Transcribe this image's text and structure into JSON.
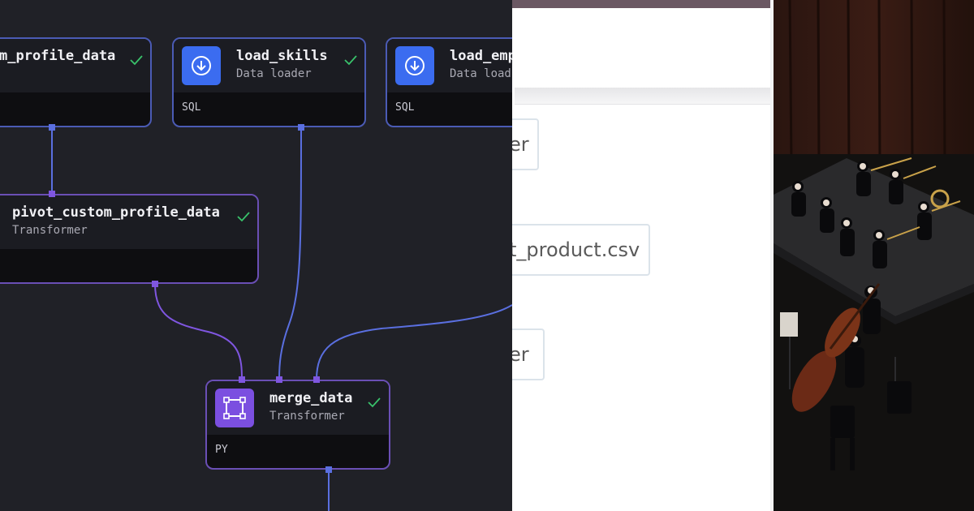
{
  "pipeline": {
    "blocks": {
      "custom_profile": {
        "name": "m_profile_data",
        "lang": ""
      },
      "load_skills": {
        "name": "load_skills",
        "type": "Data loader",
        "lang": "SQL"
      },
      "load_emp": {
        "name": "load_emp",
        "type": "Data load",
        "lang": "SQL"
      },
      "pivot": {
        "name": "pivot_custom_profile_data",
        "type": "Transformer",
        "lang": ""
      },
      "merge": {
        "name": "merge_data",
        "type": "Transformer",
        "lang": "PY"
      }
    },
    "icons": {
      "loader": "download-circle-icon",
      "transformer": "transform-square-icon",
      "status": "check-icon"
    },
    "colors": {
      "canvas": "#202127",
      "loader_accent": "#3b6cf0",
      "transformer_accent": "#7b4fe0",
      "success": "#39c26b"
    }
  },
  "files": {
    "items": [
      {
        "label": "er"
      },
      {
        "label": "t_product.csv"
      },
      {
        "label": "er"
      }
    ]
  }
}
